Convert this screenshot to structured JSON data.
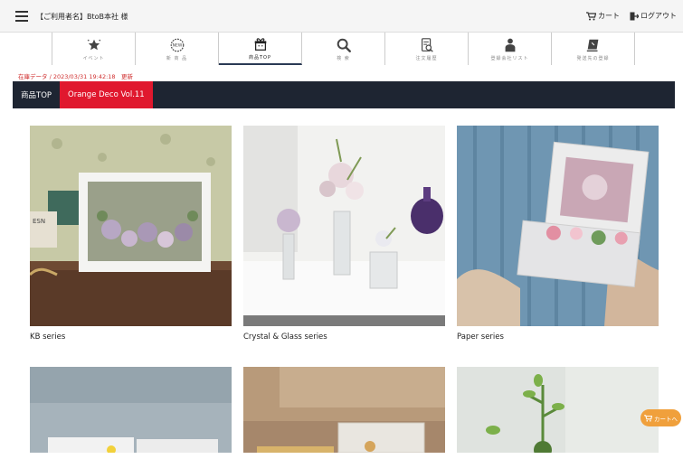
{
  "header": {
    "user_label": "【ご利用者名】BtoB本社 様",
    "cart_label": "カート",
    "logout_label": "ログアウト"
  },
  "nav": {
    "items": [
      {
        "label": "イベント",
        "icon": "event-star-icon"
      },
      {
        "label": "新 商 品",
        "icon": "new-badge-icon"
      },
      {
        "label": "商品TOP",
        "icon": "gift-box-icon",
        "active": true
      },
      {
        "label": "検 索",
        "icon": "search-icon"
      },
      {
        "label": "注文履歴",
        "icon": "order-history-icon"
      },
      {
        "label": "登録会社リスト",
        "icon": "person-icon"
      },
      {
        "label": "発送先の登録",
        "icon": "shipping-registration-icon"
      }
    ]
  },
  "stock_update": "在庫データ / 2023/03/31 19:42:18　更新",
  "category_tabs": [
    {
      "label": "商品TOP",
      "active": false
    },
    {
      "label": "Orange Deco Vol.11",
      "active": true
    }
  ],
  "products": [
    {
      "caption": "KB series"
    },
    {
      "caption": "Crystal & Glass series"
    },
    {
      "caption": "Paper series"
    }
  ],
  "floating_cart": {
    "label": "カートへ"
  },
  "colors": {
    "nav_dark": "#1e2532",
    "accent_red": "#e0182e",
    "stock_red": "#d03030",
    "cart_orange": "#f0a03c"
  }
}
